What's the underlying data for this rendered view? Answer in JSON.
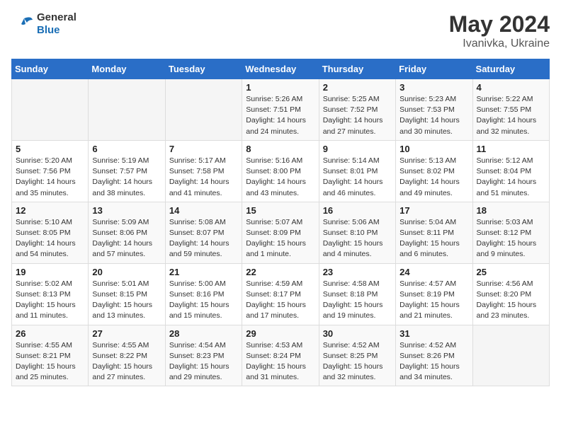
{
  "header": {
    "logo_general": "General",
    "logo_blue": "Blue",
    "title": "May 2024",
    "subtitle": "Ivanivka, Ukraine"
  },
  "weekdays": [
    "Sunday",
    "Monday",
    "Tuesday",
    "Wednesday",
    "Thursday",
    "Friday",
    "Saturday"
  ],
  "weeks": [
    [
      {
        "day": "",
        "sunrise": "",
        "sunset": "",
        "daylight": ""
      },
      {
        "day": "",
        "sunrise": "",
        "sunset": "",
        "daylight": ""
      },
      {
        "day": "",
        "sunrise": "",
        "sunset": "",
        "daylight": ""
      },
      {
        "day": "1",
        "sunrise": "Sunrise: 5:26 AM",
        "sunset": "Sunset: 7:51 PM",
        "daylight": "Daylight: 14 hours and 24 minutes."
      },
      {
        "day": "2",
        "sunrise": "Sunrise: 5:25 AM",
        "sunset": "Sunset: 7:52 PM",
        "daylight": "Daylight: 14 hours and 27 minutes."
      },
      {
        "day": "3",
        "sunrise": "Sunrise: 5:23 AM",
        "sunset": "Sunset: 7:53 PM",
        "daylight": "Daylight: 14 hours and 30 minutes."
      },
      {
        "day": "4",
        "sunrise": "Sunrise: 5:22 AM",
        "sunset": "Sunset: 7:55 PM",
        "daylight": "Daylight: 14 hours and 32 minutes."
      }
    ],
    [
      {
        "day": "5",
        "sunrise": "Sunrise: 5:20 AM",
        "sunset": "Sunset: 7:56 PM",
        "daylight": "Daylight: 14 hours and 35 minutes."
      },
      {
        "day": "6",
        "sunrise": "Sunrise: 5:19 AM",
        "sunset": "Sunset: 7:57 PM",
        "daylight": "Daylight: 14 hours and 38 minutes."
      },
      {
        "day": "7",
        "sunrise": "Sunrise: 5:17 AM",
        "sunset": "Sunset: 7:58 PM",
        "daylight": "Daylight: 14 hours and 41 minutes."
      },
      {
        "day": "8",
        "sunrise": "Sunrise: 5:16 AM",
        "sunset": "Sunset: 8:00 PM",
        "daylight": "Daylight: 14 hours and 43 minutes."
      },
      {
        "day": "9",
        "sunrise": "Sunrise: 5:14 AM",
        "sunset": "Sunset: 8:01 PM",
        "daylight": "Daylight: 14 hours and 46 minutes."
      },
      {
        "day": "10",
        "sunrise": "Sunrise: 5:13 AM",
        "sunset": "Sunset: 8:02 PM",
        "daylight": "Daylight: 14 hours and 49 minutes."
      },
      {
        "day": "11",
        "sunrise": "Sunrise: 5:12 AM",
        "sunset": "Sunset: 8:04 PM",
        "daylight": "Daylight: 14 hours and 51 minutes."
      }
    ],
    [
      {
        "day": "12",
        "sunrise": "Sunrise: 5:10 AM",
        "sunset": "Sunset: 8:05 PM",
        "daylight": "Daylight: 14 hours and 54 minutes."
      },
      {
        "day": "13",
        "sunrise": "Sunrise: 5:09 AM",
        "sunset": "Sunset: 8:06 PM",
        "daylight": "Daylight: 14 hours and 57 minutes."
      },
      {
        "day": "14",
        "sunrise": "Sunrise: 5:08 AM",
        "sunset": "Sunset: 8:07 PM",
        "daylight": "Daylight: 14 hours and 59 minutes."
      },
      {
        "day": "15",
        "sunrise": "Sunrise: 5:07 AM",
        "sunset": "Sunset: 8:09 PM",
        "daylight": "Daylight: 15 hours and 1 minute."
      },
      {
        "day": "16",
        "sunrise": "Sunrise: 5:06 AM",
        "sunset": "Sunset: 8:10 PM",
        "daylight": "Daylight: 15 hours and 4 minutes."
      },
      {
        "day": "17",
        "sunrise": "Sunrise: 5:04 AM",
        "sunset": "Sunset: 8:11 PM",
        "daylight": "Daylight: 15 hours and 6 minutes."
      },
      {
        "day": "18",
        "sunrise": "Sunrise: 5:03 AM",
        "sunset": "Sunset: 8:12 PM",
        "daylight": "Daylight: 15 hours and 9 minutes."
      }
    ],
    [
      {
        "day": "19",
        "sunrise": "Sunrise: 5:02 AM",
        "sunset": "Sunset: 8:13 PM",
        "daylight": "Daylight: 15 hours and 11 minutes."
      },
      {
        "day": "20",
        "sunrise": "Sunrise: 5:01 AM",
        "sunset": "Sunset: 8:15 PM",
        "daylight": "Daylight: 15 hours and 13 minutes."
      },
      {
        "day": "21",
        "sunrise": "Sunrise: 5:00 AM",
        "sunset": "Sunset: 8:16 PM",
        "daylight": "Daylight: 15 hours and 15 minutes."
      },
      {
        "day": "22",
        "sunrise": "Sunrise: 4:59 AM",
        "sunset": "Sunset: 8:17 PM",
        "daylight": "Daylight: 15 hours and 17 minutes."
      },
      {
        "day": "23",
        "sunrise": "Sunrise: 4:58 AM",
        "sunset": "Sunset: 8:18 PM",
        "daylight": "Daylight: 15 hours and 19 minutes."
      },
      {
        "day": "24",
        "sunrise": "Sunrise: 4:57 AM",
        "sunset": "Sunset: 8:19 PM",
        "daylight": "Daylight: 15 hours and 21 minutes."
      },
      {
        "day": "25",
        "sunrise": "Sunrise: 4:56 AM",
        "sunset": "Sunset: 8:20 PM",
        "daylight": "Daylight: 15 hours and 23 minutes."
      }
    ],
    [
      {
        "day": "26",
        "sunrise": "Sunrise: 4:55 AM",
        "sunset": "Sunset: 8:21 PM",
        "daylight": "Daylight: 15 hours and 25 minutes."
      },
      {
        "day": "27",
        "sunrise": "Sunrise: 4:55 AM",
        "sunset": "Sunset: 8:22 PM",
        "daylight": "Daylight: 15 hours and 27 minutes."
      },
      {
        "day": "28",
        "sunrise": "Sunrise: 4:54 AM",
        "sunset": "Sunset: 8:23 PM",
        "daylight": "Daylight: 15 hours and 29 minutes."
      },
      {
        "day": "29",
        "sunrise": "Sunrise: 4:53 AM",
        "sunset": "Sunset: 8:24 PM",
        "daylight": "Daylight: 15 hours and 31 minutes."
      },
      {
        "day": "30",
        "sunrise": "Sunrise: 4:52 AM",
        "sunset": "Sunset: 8:25 PM",
        "daylight": "Daylight: 15 hours and 32 minutes."
      },
      {
        "day": "31",
        "sunrise": "Sunrise: 4:52 AM",
        "sunset": "Sunset: 8:26 PM",
        "daylight": "Daylight: 15 hours and 34 minutes."
      },
      {
        "day": "",
        "sunrise": "",
        "sunset": "",
        "daylight": ""
      }
    ]
  ]
}
